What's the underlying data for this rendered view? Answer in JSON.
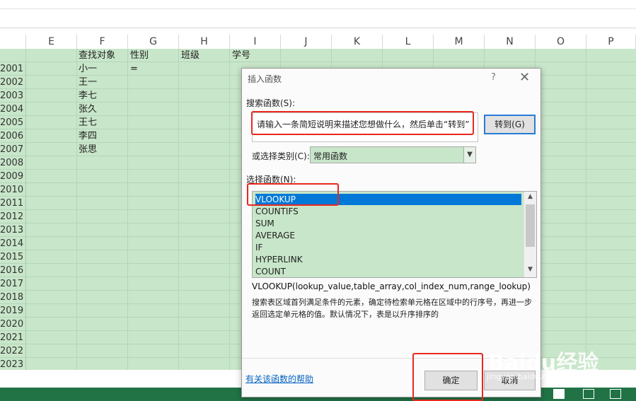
{
  "columns": [
    "E",
    "F",
    "G",
    "H",
    "I",
    "J",
    "K",
    "L",
    "M",
    "N",
    "O",
    "P"
  ],
  "header_cells": {
    "f": "查找对象",
    "g": "性别",
    "h": "班级",
    "i": "学号"
  },
  "row_numbers": [
    "2001",
    "2002",
    "2003",
    "2004",
    "2005",
    "2006",
    "2007",
    "2008",
    "2009",
    "2010",
    "2011",
    "2012",
    "2013",
    "2014",
    "2015",
    "2016",
    "2017",
    "2018",
    "2019",
    "2020",
    "2021",
    "2022",
    "2023"
  ],
  "f_values": [
    "小一",
    "王一",
    "李七",
    "张久",
    "王七",
    "李四",
    "张思"
  ],
  "g_first": "=",
  "dialog": {
    "title": "插入函数",
    "help": "?",
    "close": "✕",
    "search_label": "搜索函数(S):",
    "search_text": "请输入一条简短说明来描述您想做什么，然后单击“转到”",
    "go_button": "转到(G)",
    "category_label": "或选择类别(C):",
    "category_value": "常用函数",
    "select_label": "选择函数(N):",
    "functions": [
      "VLOOKUP",
      "COUNTIFS",
      "SUM",
      "AVERAGE",
      "IF",
      "HYPERLINK",
      "COUNT"
    ],
    "selected_function": "VLOOKUP",
    "signature": "VLOOKUP(lookup_value,table_array,col_index_num,range_lookup)",
    "description": "搜索表区域首列满足条件的元素，确定待检索单元格在区域中的行序号，再进一步返回选定单元格的值。默认情况下，表是以升序排序的",
    "help_link": "有关该函数的帮助",
    "ok_button": "确定",
    "cancel_button": "取消"
  },
  "watermark": {
    "name": "Baidu经验",
    "url": "jingyan.baidu.com"
  },
  "colors": {
    "cell_fill": "#c8e6c9",
    "highlight": "#e8281e",
    "selection": "#0078d7",
    "status_green": "#217346"
  }
}
